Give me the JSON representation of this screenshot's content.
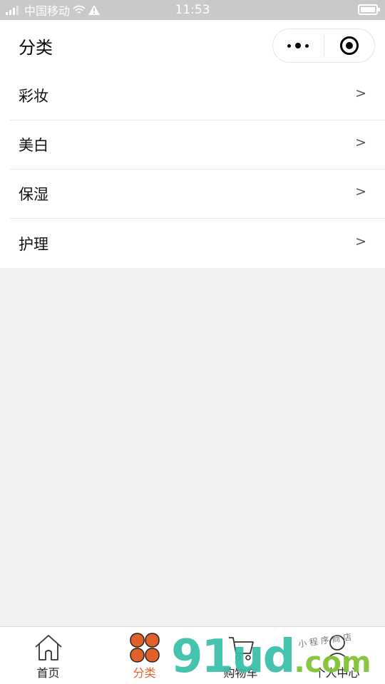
{
  "status_bar": {
    "carrier": "中国移动",
    "time": "11:53"
  },
  "header": {
    "title": "分类"
  },
  "categories": [
    {
      "label": "彩妆",
      "arrow": ">"
    },
    {
      "label": "美白",
      "arrow": ">"
    },
    {
      "label": "保湿",
      "arrow": ">"
    },
    {
      "label": "护理",
      "arrow": ">"
    }
  ],
  "tab_bar": {
    "items": [
      {
        "label": "首页",
        "icon": "home-icon",
        "active": false
      },
      {
        "label": "分类",
        "icon": "category-icon",
        "active": true
      },
      {
        "label": "购物车",
        "icon": "cart-icon",
        "active": false
      },
      {
        "label": "个人中心",
        "icon": "user-icon",
        "active": false
      }
    ]
  },
  "colors": {
    "accent": "#e0622a",
    "status_bar_bg": "#c9c9c9",
    "page_bg": "#f2f2f2"
  },
  "watermark": {
    "main": "91ud",
    "suffix": ".com",
    "sub": "小 程 序 商 店"
  }
}
